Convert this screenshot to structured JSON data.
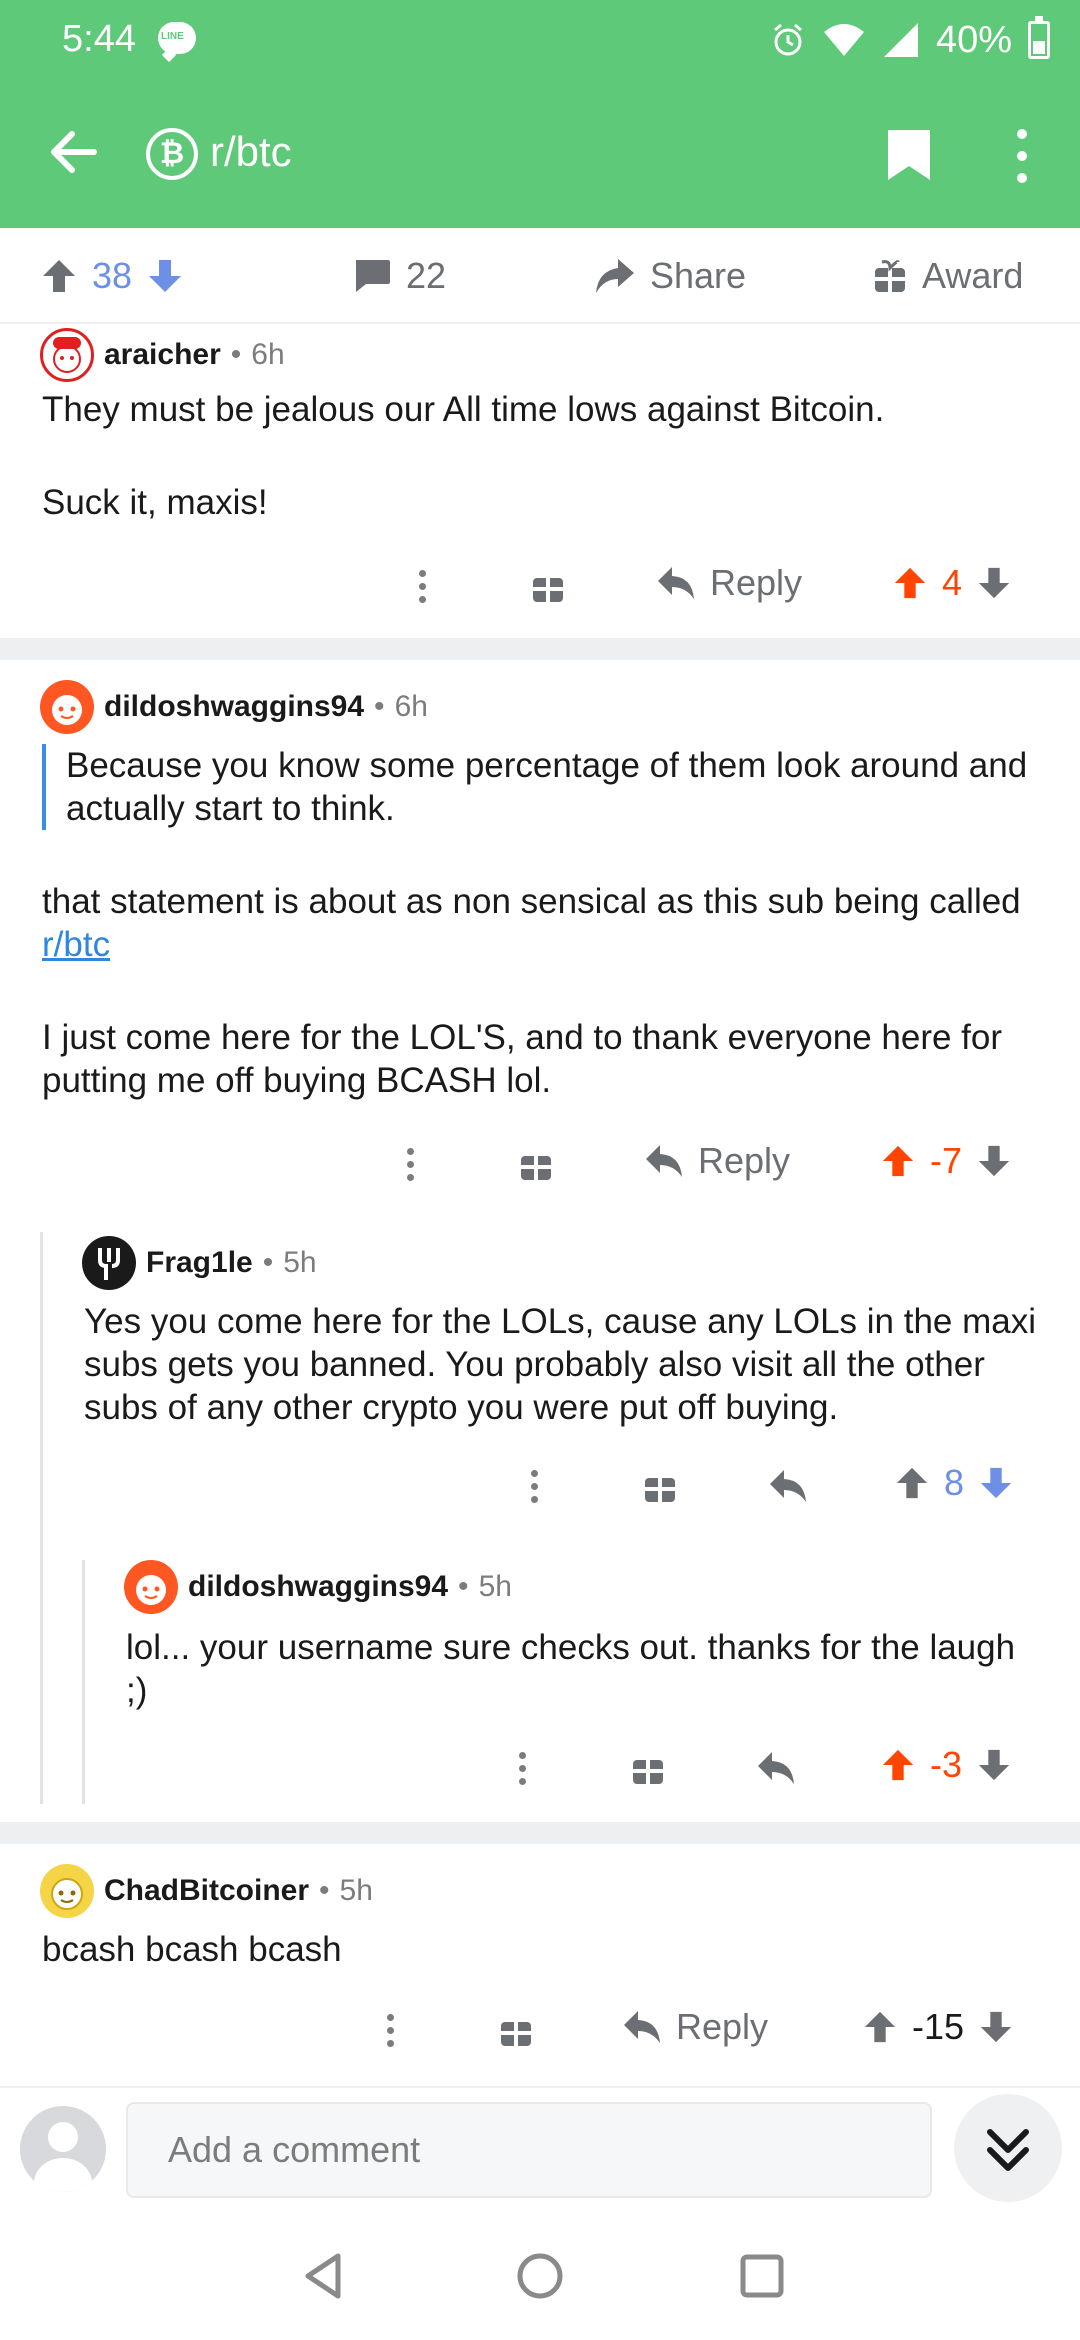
{
  "status": {
    "time": "5:44",
    "line_badge": "LINE",
    "battery": "40%",
    "battery_level": 0.4
  },
  "header": {
    "subreddit": "r/btc",
    "sub_icon_glyph": "₿"
  },
  "post_actions": {
    "upvotes": "38",
    "comments": "22",
    "share": "Share",
    "award": "Award"
  },
  "comments": [
    {
      "user": "araicher",
      "time": "6h",
      "body": [
        "They must be jealous our All time lows against Bitcoin.",
        "Suck it, maxis!"
      ],
      "reply": "Reply",
      "score": "4",
      "vote": "up"
    },
    {
      "user": "dildoshwaggins94",
      "time": "6h",
      "quote": "Because you know some percentage of them look around and actually start to think.",
      "body_pre": "that statement is about as non sensical as this sub being called ",
      "link": "r/btc",
      "body2": "I just come here for the LOL'S, and to thank everyone here for putting me off buying BCASH lol.",
      "reply": "Reply",
      "score": "-7",
      "vote": "up"
    },
    {
      "user": "Frag1le",
      "time": "5h",
      "body": "Yes you come here for the LOLs, cause any LOLs in the maxi subs gets you banned. You probably also visit all the other subs of any other crypto you were put off buying.",
      "score": "8",
      "vote": "down"
    },
    {
      "user": "dildoshwaggins94",
      "time": "5h",
      "body": "lol... your username sure checks out. thanks for the laugh ;)",
      "score": "-3",
      "vote": "up"
    },
    {
      "user": "ChadBitcoiner",
      "time": "5h",
      "body": "bcash bcash bcash",
      "reply": "Reply",
      "score": "-15",
      "vote": "none"
    }
  ],
  "composer": {
    "placeholder": "Add a comment"
  },
  "colors": {
    "header_green": "#5ec978",
    "upvote": "#ff4500",
    "downvote": "#6d8fe6",
    "link": "#2e86de"
  }
}
